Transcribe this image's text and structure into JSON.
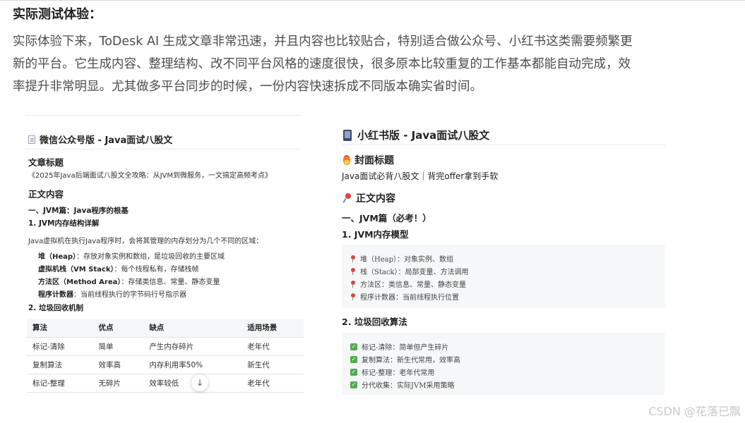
{
  "section_heading": "实际测试体验：",
  "intro_lines": [
    "实际体验下来，ToDesk AI 生成文章非常迅速，并且内容也比较贴合，特别适合做公众号、小红书这类需要频繁更",
    "新的平台。它生成内容、整理结构、改不同平台风格的速度很快，很多原本比较重复的工作基本都能自动完成，效",
    "率提升非常明显。尤其做多平台同步的时候，一份内容快速拆成不同版本确实省时间。"
  ],
  "wechat": {
    "title": "微信公众号版 - Java面试八股文",
    "article_title_label": "文章标题",
    "article_title": "《2025年Java后端面试八股文全攻略：从JVM到微服务，一文搞定高频考点》",
    "body_label": "正文内容",
    "part1": "一、JVM篇：Java程序的根基",
    "sec1": "1. JVM内存结构详解",
    "sec1_intro": "Java虚拟机在执行Java程序时，会将其管理的内存划分为几个不同的区域：",
    "memory_items": [
      {
        "term": "堆（Heap）",
        "desc": "：存放对象实例和数组，是垃圾回收的主要区域"
      },
      {
        "term": "虚拟机栈（VM Stack）",
        "desc": "：每个线程私有，存储栈帧"
      },
      {
        "term": "方法区（Method Area）",
        "desc": "：存储类信息、常量、静态变量"
      },
      {
        "term": "程序计数器",
        "desc": "：当前线程执行的字节码行号指示器"
      }
    ],
    "sec2": "2. 垃圾回收机制",
    "table": {
      "headers": [
        "算法",
        "优点",
        "缺点",
        "适用场景"
      ],
      "rows": [
        [
          "标记-清除",
          "简单",
          "产生内存碎片",
          "老年代"
        ],
        [
          "复制算法",
          "效率高",
          "内存利用率50%",
          "新生代"
        ],
        [
          "标记-整理",
          "无碎片",
          "效率较低",
          "老年代"
        ]
      ]
    },
    "scroll_glyph": "↓"
  },
  "xiaohongshu": {
    "title": "小红书版 - Java面试八股文",
    "cover_label": "封面标题",
    "cover_title": "Java面试必背八股文｜背完offer拿到手软",
    "body_label": "正文内容",
    "part1": "一、JVM篇（必考！）",
    "sec1": "1. JVM内存模型",
    "memory_items": [
      "堆（Heap）：对象实例、数组",
      "栈（Stack）：局部变量、方法调用",
      "方法区：类信息、常量、静态变量",
      "程序计数器：当前线程执行位置"
    ],
    "sec2": "2. 垃圾回收算法",
    "gc_items": [
      "标记-清除：简单但产生碎片",
      "复制算法：新生代常用，效率高",
      "标记-整理：老年代常用",
      "分代收集：实际JVM采用策略"
    ],
    "check_glyph": "✓"
  },
  "watermark": "CSDN @花落已飘"
}
